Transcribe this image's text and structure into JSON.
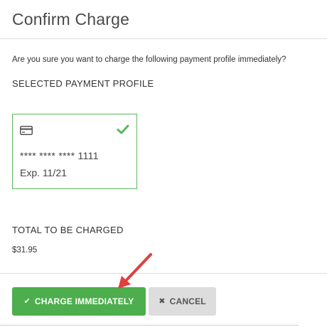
{
  "dialog": {
    "title": "Confirm Charge",
    "prompt": "Are you sure you want to charge the following payment profile immediately?"
  },
  "profile": {
    "section_label": "SELECTED PAYMENT PROFILE",
    "card_number": "**** **** **** 1111",
    "expiry": "Exp. 11/21",
    "icon": "credit-card-icon",
    "selected_icon": "checkmark-icon"
  },
  "total": {
    "label": "TOTAL TO BE CHARGED",
    "amount": "$31.95"
  },
  "buttons": {
    "charge_label": "CHARGE IMMEDIATELY",
    "charge_icon": "check-icon",
    "cancel_label": "CANCEL",
    "cancel_icon": "x-icon"
  },
  "annotation": {
    "icon": "red-arrow-pointer",
    "color": "#e04040"
  },
  "colors": {
    "success": "#4cae4c",
    "selected_border": "#5cb85c",
    "cancel_bg": "#dddddd"
  }
}
